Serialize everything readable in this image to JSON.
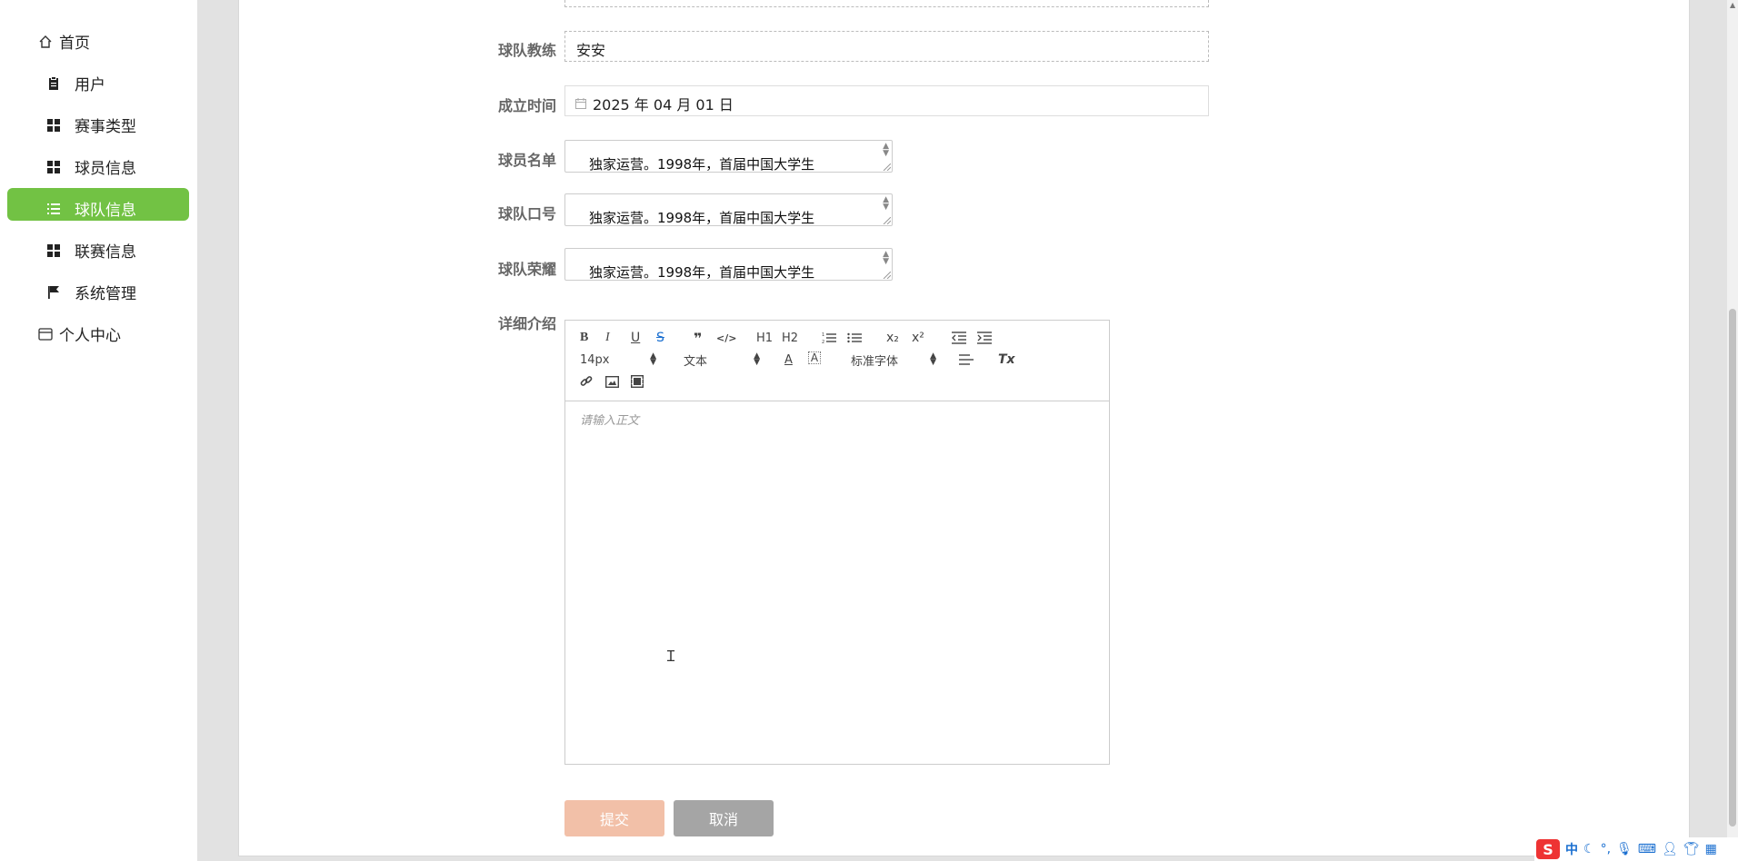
{
  "sidebar": {
    "items": [
      {
        "label": "首页",
        "icon": "home-icon"
      },
      {
        "label": "用户",
        "icon": "clipboard-icon"
      },
      {
        "label": "赛事类型",
        "icon": "grid-icon"
      },
      {
        "label": "球员信息",
        "icon": "grid-icon"
      },
      {
        "label": "球队信息",
        "icon": "list-icon",
        "active": true
      },
      {
        "label": "联赛信息",
        "icon": "grid-icon"
      },
      {
        "label": "系统管理",
        "icon": "flag-icon"
      },
      {
        "label": "个人中心",
        "icon": "card-icon"
      }
    ],
    "active_color": "#72c244"
  },
  "form": {
    "coach": {
      "label": "球队教练",
      "value": "安安"
    },
    "founded": {
      "label": "成立时间",
      "value": "2025 年 04 月 01 日"
    },
    "roster": {
      "label": "球员名单",
      "value": "独家运营。1998年，首届中国大学生"
    },
    "slogan": {
      "label": "球队口号",
      "value": "独家运营。1998年，首届中国大学生"
    },
    "honors": {
      "label": "球队荣耀",
      "value": "独家运营。1998年，首届中国大学生"
    },
    "detail": {
      "label": "详细介绍"
    }
  },
  "editor": {
    "font_size": "14px",
    "header_select": "文本",
    "font_family": "标准字体",
    "placeholder": "请输入正文",
    "buttons": {
      "bold": "B",
      "italic": "I",
      "underline": "U",
      "strike": "S",
      "quote": "❞",
      "code": "</>",
      "h1": "H1",
      "h2": "H2",
      "ordered_list": "≡",
      "bullet_list": "≡",
      "subscript": "x₂",
      "superscript": "x²",
      "outdent": "⇤",
      "indent": "⇥",
      "color": "A",
      "background": "A",
      "align": "≡",
      "clean": "Tx"
    }
  },
  "actions": {
    "submit": "提交",
    "cancel": "取消",
    "submit_color": "#f2c0a8",
    "cancel_color": "#a5a5a5"
  },
  "ime": {
    "lang": "中"
  }
}
